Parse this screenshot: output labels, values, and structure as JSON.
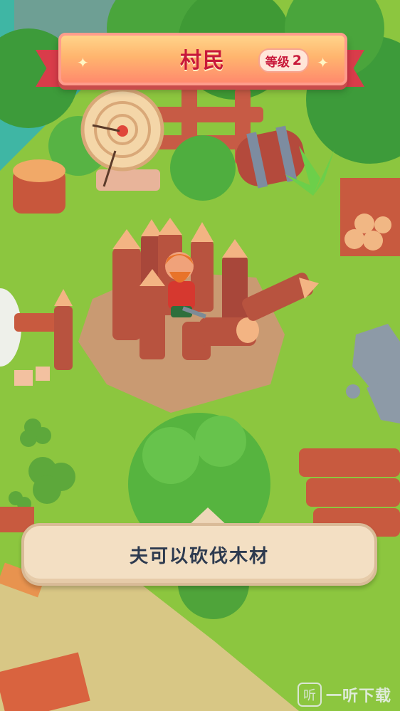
{
  "header": {
    "title": "村民",
    "level_label": "等级",
    "level_value": "2"
  },
  "dialog": {
    "text": "夫可以砍伐木材"
  },
  "watermark": {
    "icon_glyph": "听",
    "text": "一听下载"
  },
  "colors": {
    "grass": "#8cc63f",
    "banner_title": "#c8183a",
    "ribbon": "#d93c4a",
    "dialog_bg": "#f3dfc3",
    "dialog_text": "#2d3a4f"
  }
}
